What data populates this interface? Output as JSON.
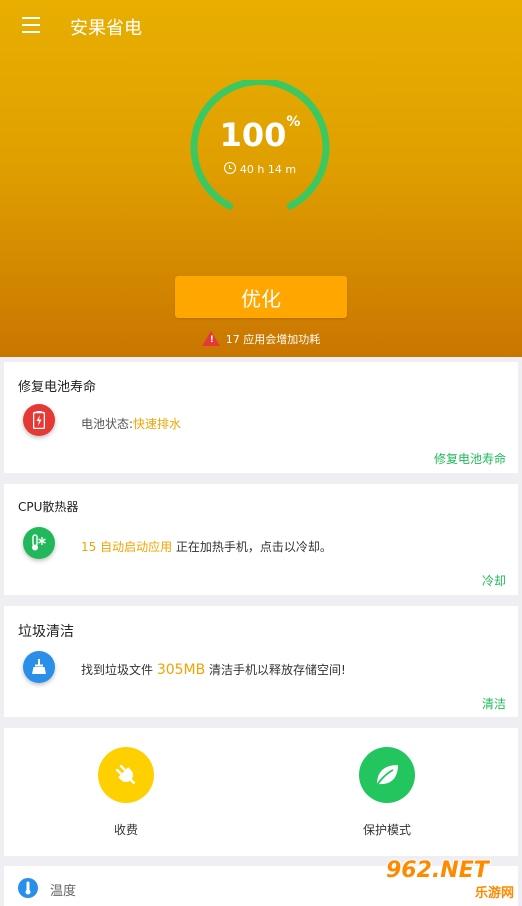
{
  "app": {
    "title": "安果省电"
  },
  "battery": {
    "percent_value": "100",
    "percent_sign": "%",
    "percent_fraction": 1.0,
    "remaining": "40 h 14 m"
  },
  "optimize": {
    "label": "优化",
    "warning": "17 应用会增加功耗"
  },
  "cards": {
    "battery_life": {
      "title": "修复电池寿命",
      "status_prefix": "电池状态:",
      "status_value": "快速排水",
      "action": "修复电池寿命"
    },
    "cpu": {
      "title": "CPU散热器",
      "highlight": "15 自动启动应用",
      "text": " 正在加热手机，点击以冷却。",
      "action": "冷却"
    },
    "junk": {
      "title": "垃圾清洁",
      "prefix": "找到垃圾文件 ",
      "size": "305MB",
      "suffix": " 清洁手机以释放存储空间!",
      "action": "清洁"
    }
  },
  "shortcuts": {
    "charge_label": "收费",
    "protect_label": "保护模式"
  },
  "temperature": {
    "label": "温度"
  },
  "watermark": {
    "main": "962.NET",
    "sub": "乐游网"
  },
  "colors": {
    "header_top": "#e8ae00",
    "header_bottom": "#c97600",
    "gauge": "#3cc860",
    "button": "#ffa600",
    "highlight": "#f0a400",
    "action": "#1fba5a",
    "battery_icon": "#e53935",
    "cpu_icon": "#20b85a",
    "junk_icon": "#2a8fe8",
    "charge_icon": "#ffd000",
    "protect_icon": "#22c55e"
  },
  "icons": [
    "menu-icon",
    "clock-icon",
    "warning-icon",
    "battery-icon",
    "thermometer-icon",
    "broom-icon",
    "plug-icon",
    "leaf-icon",
    "thermometer-small-icon"
  ]
}
